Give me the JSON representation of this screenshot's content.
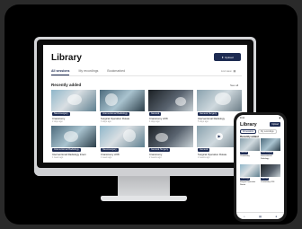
{
  "desktop": {
    "page_title": "Library",
    "upload_label": "Upload",
    "tabs": [
      {
        "label": "All sessions",
        "active": true
      },
      {
        "label": "My recordings",
        "active": false
      },
      {
        "label": "Bookmarked",
        "active": false
      }
    ],
    "view_label": "List view",
    "section_title": "Recently added",
    "see_all": "See all",
    "cards": [
      {
        "badge": "Neurosurgery",
        "title": "Craniotomy",
        "meta": "2 days ago"
      },
      {
        "badge": "Interventional Radiology",
        "title": "Surgical Operation Rotate",
        "meta": "3 days ago"
      },
      {
        "badge": "General",
        "title": "Craniotomy 2/28",
        "meta": "4 days ago"
      },
      {
        "badge": "General Surgery",
        "title": "Interventional Radiology",
        "meta": "5 days ago"
      },
      {
        "badge": "Interventional Radiology",
        "title": "Interventional Radiology Intern",
        "meta": "1 week ago"
      },
      {
        "badge": "Neurosurgery",
        "title": "Craniotomy 2/28",
        "meta": "1 week ago"
      },
      {
        "badge": "General Surgery",
        "title": "Craniotomy",
        "meta": "2 weeks ago"
      },
      {
        "badge": "General",
        "title": "Surgical Operation Rotate",
        "meta": "2 weeks ago"
      }
    ]
  },
  "phone": {
    "status_time": "9:41",
    "page_title": "Library",
    "upload_label": "Upload",
    "tabs": [
      {
        "label": "All sessions",
        "active": true
      },
      {
        "label": "My recordings",
        "active": false
      }
    ],
    "section_title": "Recently added",
    "cards": [
      {
        "badge": "General",
        "title": "Craniotomy"
      },
      {
        "badge": "Neurosurgery",
        "title": "Interventional Radiology"
      },
      {
        "badge": "Radiology",
        "title": "Surgical Operation Rotate"
      },
      {
        "badge": "General",
        "title": "Craniotomy 2/28"
      }
    ]
  },
  "colors": {
    "accent": "#1d2b52",
    "frame": "#000000",
    "background": "#2a2a2a"
  }
}
